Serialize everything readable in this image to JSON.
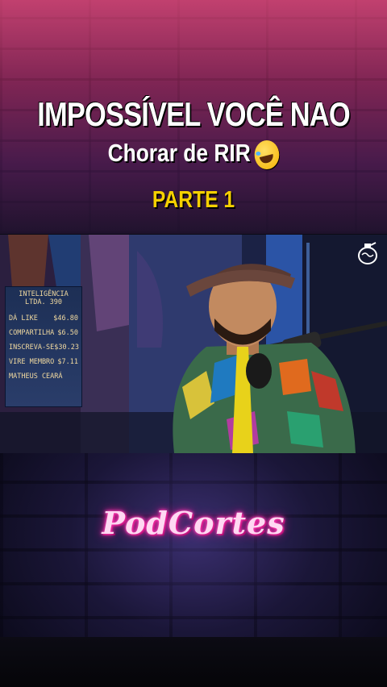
{
  "overlay": {
    "title_line1": "IMPOSSÍVEL VOCÊ NAO",
    "title_line2": "Chorar de RIR",
    "title_emoji": "rolling-on-floor-laughing-emoji",
    "part_label": "PARTE 1",
    "watermark": "PodCortes"
  },
  "video_frame": {
    "board": {
      "header_line1": "INTELIGÊNCIA",
      "header_line2": "LTDA. 390",
      "rows": [
        {
          "label": "DÁ LIKE",
          "value": "$46.80"
        },
        {
          "label": "COMPARTILHA",
          "value": "$6.50"
        },
        {
          "label": "INSCREVA-SE",
          "value": "$30.23"
        },
        {
          "label": "VIRE MEMBRO",
          "value": "$7.11"
        },
        {
          "label": "MATHEUS CEARÁ",
          "value": ""
        }
      ]
    },
    "channel_logo": "brain-grenade-icon"
  },
  "colors": {
    "title_text": "#ffffff",
    "part_text": "#f5d000",
    "watermark_glow": "#ff3fb6",
    "top_wall": "#c03a7a",
    "bottom_wall": "#2a2460"
  }
}
